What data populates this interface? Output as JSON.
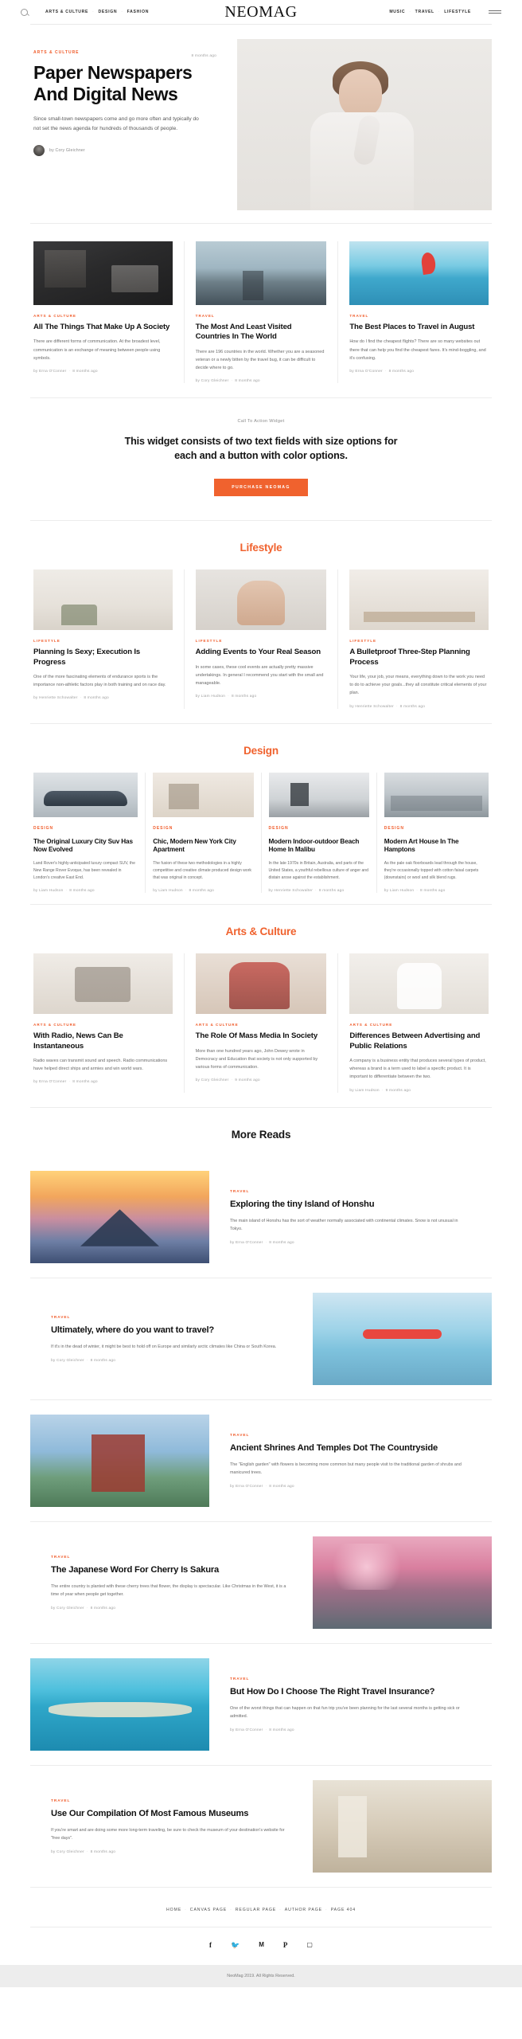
{
  "header": {
    "search_icon": "search-icon",
    "nav_left": [
      "ARTS & CULTURE",
      "DESIGN",
      "FASHION"
    ],
    "brand": "NEOMAG",
    "nav_right": [
      "MUSIC",
      "TRAVEL",
      "LIFESTYLE"
    ],
    "menu_icon": "hamburger-icon"
  },
  "hero": {
    "kicker": "ARTS & CULTURE",
    "date": "8 months ago",
    "title": "Paper Newspapers And Digital News",
    "dek": "Since small-town newspapers come and go more often and typically do not set the news agenda for hundreds of thousands of people.",
    "author": "by Cory Gleichner",
    "image": "woman-in-white-shirt-portrait"
  },
  "featured": [
    {
      "kicker": "ARTS & CULTURE",
      "title": "All The Things That Make Up A Society",
      "dek": "There are different forms of communication. At the broadest level, communication is an exchange of meaning between people using symbols.",
      "author": "by Erna O'Conner",
      "date": "8 months ago",
      "image": "man-reading-in-library"
    },
    {
      "kicker": "TRAVEL",
      "title": "The Most And Least Visited Countries In The World",
      "dek": "There are 196 countries in the world. Whether you are a seasoned veteran or a newly bitten by the travel bug, it can be difficult to decide where to go.",
      "author": "by Cory Gleichner",
      "date": "8 months ago",
      "image": "person-on-lake-pier"
    },
    {
      "kicker": "TRAVEL",
      "title": "The Best Places to Travel in August",
      "dek": "How do I find the cheapest flights? There are so many websites out there that can help you find the cheapest fares. It's mind-boggling, and it's confusing.",
      "author": "by Erna O'Conner",
      "date": "8 months ago",
      "image": "red-umbrella-on-beach"
    }
  ],
  "cta": {
    "eyebrow": "Call To Action Widget",
    "headline": "This widget consists of two text fields with size options for each and a button with color options.",
    "button": "PURCHASE NEOMAG",
    "button_color": "#f0622e"
  },
  "sections": [
    {
      "heading": "Lifestyle",
      "heading_color": "#f0622e",
      "layout": "three",
      "cards": [
        {
          "kicker": "LIFESTYLE",
          "title": "Planning Is Sexy; Execution Is Progress",
          "dek": "One of the more fascinating elements of endurance sports is the importance non-athletic factors play in both training and on race day.",
          "author": "by Henriette Schowalter",
          "date": "8 months ago",
          "image": "minimal-plant-interior"
        },
        {
          "kicker": "LIFESTYLE",
          "title": "Adding Events to Your Real Season",
          "dek": "In some cases, these cool events are actually pretty massive undertakings. In general I recommend you start with the small and manageable.",
          "author": "by Liam Hudson",
          "date": "8 months ago",
          "image": "smiling-woman-portrait"
        },
        {
          "kicker": "LIFESTYLE",
          "title": "A Bulletproof Three-Step Planning Process",
          "dek": "Your life, your job, your means, everything down to the work you need to do to achieve your goals...they all constitute critical elements of your plan.",
          "author": "by Henriette Schowalter",
          "date": "8 months ago",
          "image": "desk-workspace"
        }
      ]
    },
    {
      "heading": "Design",
      "heading_color": "#f0622e",
      "layout": "four",
      "cards": [
        {
          "kicker": "DESIGN",
          "title": "The Original Luxury City Suv Has Now Evolved",
          "dek": "Land Rover's highly-anticipated luxury compact SUV, the New Range Rover Evoque, has been revealed in London's creative East End.",
          "author": "by Liam Hudson",
          "date": "8 months ago",
          "image": "silver-luxury-suv"
        },
        {
          "kicker": "DESIGN",
          "title": "Chic, Modern New York City Apartment",
          "dek": "The fusion of these two methodologies in a highly competitive and creative climate produced design work that was original in concept.",
          "author": "by Liam Hudson",
          "date": "8 months ago",
          "image": "modern-apartment-interior"
        },
        {
          "kicker": "DESIGN",
          "title": "Modern Indoor-outdoor Beach Home In Malibu",
          "dek": "In the late 1970s in Britain, Australia, and parts of the United States, a youthful rebellious culture of anger and distain arose against the establishment.",
          "author": "by Henriette Schowalter",
          "date": "8 months ago",
          "image": "man-viewing-art"
        },
        {
          "kicker": "DESIGN",
          "title": "Modern Art House In The Hamptons",
          "dek": "As the pale oak floorboards lead through the house, they're occasionally topped with cotton faisal carpets (downstairs) or wool and silk blend rugs.",
          "author": "by Liam Hudson",
          "date": "8 months ago",
          "image": "open-plan-living-room"
        }
      ]
    },
    {
      "heading": "Arts & Culture",
      "heading_color": "#f0622e",
      "layout": "three",
      "cards": [
        {
          "kicker": "ARTS & CULTURE",
          "title": "With Radio, News Can Be Instantaneous",
          "dek": "Radio waves can transmit sound and speech. Radio communications have helped direct ships and armies and win world wars.",
          "author": "by Erna O'Conner",
          "date": "8 months ago",
          "image": "vintage-radio-desk"
        },
        {
          "kicker": "ARTS & CULTURE",
          "title": "The Role Of Mass Media In Society",
          "dek": "More than one hundred years ago, John Dewey wrote in Democracy and Education that society is not only supported by various forms of communication.",
          "author": "by Cory Gleichner",
          "date": "9 months ago",
          "image": "woman-in-red-jacket"
        },
        {
          "kicker": "ARTS & CULTURE",
          "title": "Differences Between Advertising and Public Relations",
          "dek": "A company is a business entity that produces several types of product, whereas a brand is a term used to label a specific product. It is important to differentiate between the two.",
          "author": "by Liam Hudson",
          "date": "9 months ago",
          "image": "woman-in-white-coat"
        }
      ]
    }
  ],
  "more_reads": {
    "heading": "More Reads",
    "items": [
      {
        "kicker": "TRAVEL",
        "title": "Exploring the tiny Island of Honshu",
        "dek": "The main island of Honshu has the sort of weather normally associated with continental climates. Snow is not unusual in Tokyo.",
        "author": "by Erna O'Conner",
        "date": "8 months ago",
        "image": "mount-fuji-sunset",
        "image_side": "left"
      },
      {
        "kicker": "TRAVEL",
        "title": "Ultimately, where do you want to travel?",
        "dek": "If it's in the dead of winter, it might be best to hold off on Europe and similarly arctic climates like China or South Korea.",
        "author": "by Cory Gleichner",
        "date": "8 months ago",
        "image": "seaplane-on-coast",
        "image_side": "right"
      },
      {
        "kicker": "TRAVEL",
        "title": "Ancient Shrines And Temples Dot The Countryside",
        "dek": "The \"English garden\" with flowers is becoming more common but many people visit to the traditional garden of shrubs and manicured trees.",
        "author": "by Erna O'Conner",
        "date": "8 months ago",
        "image": "japanese-pagoda",
        "image_side": "left"
      },
      {
        "kicker": "TRAVEL",
        "title": "The Japanese Word For Cherry Is Sakura",
        "dek": "The entire country is planted with these cherry trees that flower, the display is spectacular. Like Christmas in the West, it is a time of year when people get together.",
        "author": "by Cory Gleichner",
        "date": "8 months ago",
        "image": "cherry-blossom-landscape",
        "image_side": "right"
      },
      {
        "kicker": "TRAVEL",
        "title": "But How Do I Choose The Right Travel Insurance?",
        "dek": "One of the worst things that can happen on that fun trip you've been planning for the last several months is getting sick or admitted.",
        "author": "by Erna O'Conner",
        "date": "8 months ago",
        "image": "tropical-island-beach",
        "image_side": "left"
      },
      {
        "kicker": "TRAVEL",
        "title": "Use Our Compilation Of Most Famous Museums",
        "dek": "If you're smart and are doing some more long-term traveling, be sure to check the museum of your destination's website for \"free days\".",
        "author": "by Cory Gleichner",
        "date": "8 months ago",
        "image": "museum-courtyard-visitors",
        "image_side": "right"
      }
    ]
  },
  "footer": {
    "nav": [
      "HOME",
      "CANVAS PAGE",
      "REGULAR PAGE",
      "AUTHOR PAGE",
      "PAGE 404"
    ],
    "socials": [
      "facebook-icon",
      "twitter-icon",
      "medium-icon",
      "pinterest-icon",
      "instagram-icon"
    ],
    "social_glyphs": [
      "f",
      "𝐓",
      "M",
      "𝐏",
      "▢"
    ],
    "copyright": "NeoMag 2019. All Rights Reserved."
  }
}
